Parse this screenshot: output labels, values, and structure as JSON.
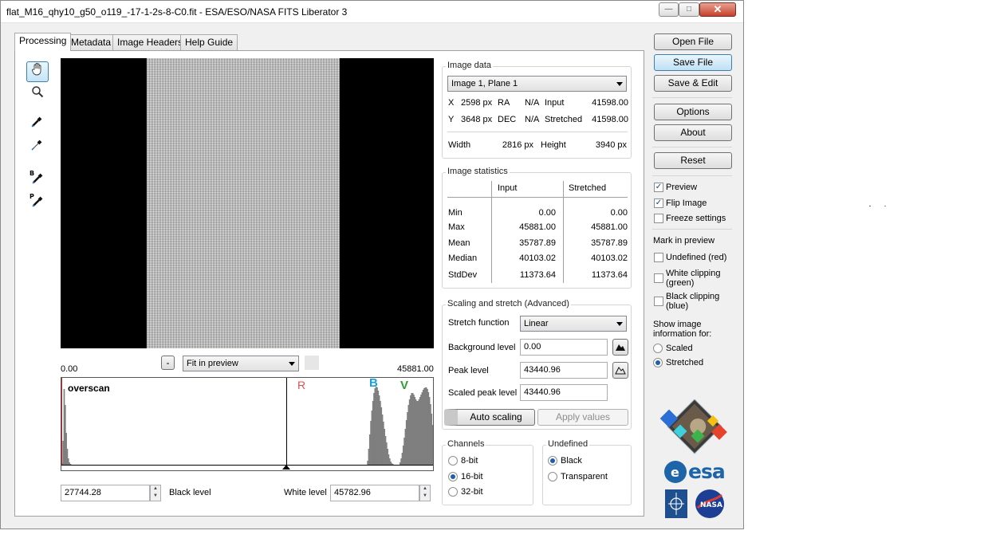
{
  "window": {
    "title": "flat_M16_qhy10_g50_o119_-17-1-2s-8-C0.fit - ESA/ESO/NASA FITS Liberator 3"
  },
  "tabs": [
    "Processing",
    "Metadata",
    "Image Headers",
    "Help Guide"
  ],
  "active_tab": "Processing",
  "tools": [
    "hand-icon",
    "zoom-icon",
    "pick-black-icon",
    "pick-white-icon",
    "pick-background-icon",
    "pick-peak-icon"
  ],
  "preview": {
    "zoom": "Fit in preview",
    "zoom_minus": "-",
    "hist_min": "0.00",
    "hist_max": "45881.00",
    "annotation": "overscan",
    "marker_r": "R",
    "marker_b": "B",
    "marker_v": "V",
    "black_level_label": "Black level",
    "black_level": "27744.28",
    "white_level_label": "White level",
    "white_level": "45782.96",
    "histogram": [
      2,
      30,
      95,
      75,
      40,
      20,
      8,
      3,
      1,
      0,
      0,
      0,
      0,
      0,
      0,
      0,
      0,
      0,
      0,
      0,
      0,
      0,
      0,
      0,
      0,
      0,
      0,
      0,
      0,
      0,
      0,
      0,
      0,
      0,
      0,
      0,
      0,
      0,
      0,
      0,
      0,
      0,
      0,
      0,
      0,
      0,
      0,
      0,
      0,
      0,
      0,
      0,
      0,
      0,
      0,
      0,
      0,
      0,
      0,
      0,
      0,
      0,
      0,
      0,
      0,
      0,
      0,
      0,
      0,
      0,
      0,
      0,
      0,
      0,
      0,
      0,
      0,
      0,
      0,
      0,
      0,
      0,
      0,
      0,
      0,
      0,
      0,
      0,
      0,
      0,
      0,
      0,
      0,
      0,
      0,
      0,
      0,
      0,
      0,
      0,
      0,
      0,
      0,
      0,
      0,
      0,
      0,
      0,
      0,
      0,
      0,
      0,
      0,
      0,
      0,
      0,
      0,
      0,
      0,
      0,
      0,
      0,
      0,
      0,
      0,
      0,
      0,
      0,
      0,
      0,
      0,
      0,
      0,
      0,
      0,
      0,
      0,
      0,
      0,
      0,
      0,
      0,
      0,
      0,
      0,
      0,
      0,
      0,
      0,
      0,
      0,
      0,
      0,
      0,
      0,
      0,
      0,
      0,
      0,
      0,
      0,
      0,
      0,
      0,
      0,
      0,
      0,
      0,
      0,
      0,
      0,
      0,
      0,
      0,
      0,
      0,
      0,
      0,
      0,
      0,
      0,
      0,
      0,
      0,
      0,
      0,
      0,
      0,
      0,
      0,
      0,
      0,
      0,
      0,
      0,
      0,
      0,
      0,
      0,
      0,
      0,
      0,
      0,
      0,
      0,
      0,
      0,
      0,
      0,
      0,
      0,
      0,
      0,
      0,
      0,
      0,
      0,
      0,
      0,
      0,
      0,
      0,
      0,
      0,
      0,
      0,
      0,
      0,
      0,
      0,
      0,
      0,
      0,
      0,
      0,
      0,
      0,
      0,
      0,
      0,
      0,
      0,
      0,
      0,
      0,
      0,
      0,
      0,
      0,
      0,
      0,
      0,
      0,
      0,
      0,
      0,
      0,
      0,
      0,
      0,
      0,
      0,
      0,
      0,
      0,
      0,
      0,
      0,
      0,
      0,
      0,
      0,
      0,
      0,
      0,
      0,
      0,
      0,
      0,
      0,
      0,
      0,
      0,
      0,
      0,
      0,
      0,
      0,
      0,
      0,
      0,
      0,
      5,
      20,
      38,
      55,
      68,
      80,
      90,
      96,
      98,
      97,
      93,
      87,
      80,
      72,
      63,
      54,
      45,
      36,
      28,
      20,
      13,
      8,
      4,
      2,
      1,
      0,
      0,
      0,
      0,
      0,
      0,
      3,
      8,
      15,
      24,
      34,
      45,
      56,
      66,
      75,
      82,
      87,
      90,
      90,
      88,
      85,
      82,
      80,
      80,
      82,
      85,
      88,
      91,
      94,
      96,
      97,
      97,
      95,
      91,
      85,
      76,
      64,
      50
    ]
  },
  "image_data": {
    "label": "Image data",
    "plane": "Image 1, Plane 1",
    "x_label": "X",
    "x_value": "2598 px",
    "ra_label": "RA",
    "ra_value": "N/A",
    "input_label": "Input",
    "input_value": "41598.00",
    "y_label": "Y",
    "y_value": "3648 px",
    "dec_label": "DEC",
    "dec_value": "N/A",
    "stretched_label": "Stretched",
    "stretched_value": "41598.00",
    "width_label": "Width",
    "width_value": "2816 px",
    "height_label": "Height",
    "height_value": "3940 px"
  },
  "stats": {
    "label": "Image statistics",
    "col_input": "Input",
    "col_stretched": "Stretched",
    "rows": [
      {
        "name": "Min",
        "input": "0.00",
        "stretched": "0.00"
      },
      {
        "name": "Max",
        "input": "45881.00",
        "stretched": "45881.00"
      },
      {
        "name": "Mean",
        "input": "35787.89",
        "stretched": "35787.89"
      },
      {
        "name": "Median",
        "input": "40103.02",
        "stretched": "40103.02"
      },
      {
        "name": "StdDev",
        "input": "11373.64",
        "stretched": "11373.64"
      }
    ]
  },
  "scaling": {
    "label": "Scaling and stretch (Advanced)",
    "stretch_label": "Stretch function",
    "stretch_value": "Linear",
    "bg_label": "Background level",
    "bg_value": "0.00",
    "peak_label": "Peak level",
    "peak_value": "43440.96",
    "scaled_peak_label": "Scaled peak level",
    "scaled_peak_value": "43440.96",
    "auto_button": "Auto scaling",
    "apply_button": "Apply values"
  },
  "channels": {
    "label": "Channels",
    "options": [
      "8-bit",
      "16-bit",
      "32-bit"
    ],
    "selected": "16-bit"
  },
  "undefined_group": {
    "label": "Undefined",
    "options": [
      "Black",
      "Transparent"
    ],
    "selected": "Black"
  },
  "side": {
    "open_file": "Open File",
    "save_file": "Save File",
    "save_edit": "Save & Edit",
    "options": "Options",
    "about": "About",
    "reset": "Reset",
    "preview": "Preview",
    "flip_image": "Flip Image",
    "freeze_settings": "Freeze settings",
    "mark_in_preview": "Mark in preview",
    "undefined_red": "Undefined (red)",
    "white_clipping_1": "White clipping",
    "white_clipping_2": "(green)",
    "black_clipping_1": "Black clipping",
    "black_clipping_2": "(blue)",
    "show_info_1": "Show image",
    "show_info_2": "information for:",
    "scaled": "Scaled",
    "stretched": "Stretched",
    "esa_logo": "esa"
  },
  "colors": {
    "accent": "#3c7fb1",
    "marker_r": "#d9534f",
    "marker_b": "#1aa0d8",
    "marker_v": "#2ca02c",
    "histogram": "#7f7f7f"
  }
}
